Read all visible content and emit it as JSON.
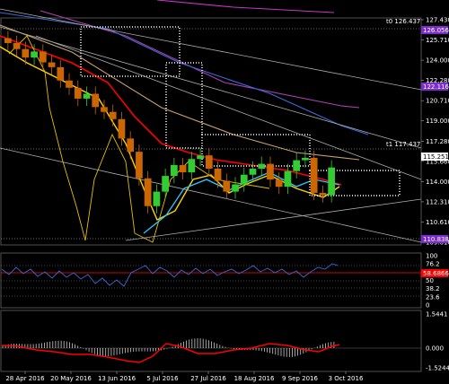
{
  "colors": {
    "background": "#000000",
    "bull_candle": "#33cc33",
    "bear_candle": "#cc6600",
    "ma_red": "#ff0000",
    "ma_yellow": "#ffd400",
    "ma_cyan": "#2ec8ff",
    "ma_blue": "#3b6bd9",
    "ma_purple": "#c04ac0",
    "ma_magenta": "#cc33cc",
    "ma_tan": "#d8b078",
    "cloud": "#ffffff",
    "tag_purple": "#7a2ccc",
    "tag_blue_grey": "#6c6c9a",
    "tag_current": "#ffffff",
    "rsi_line": "#3a6bd8",
    "macd_line": "#ff0000",
    "macd_hist": "#cccccc",
    "grid": "#444444",
    "trendline": "#bbbbbb"
  },
  "price_axis": {
    "labels": [
      "127.430",
      "125.710",
      "124.000",
      "122.280",
      "120.710",
      "119.000",
      "117.280",
      "115.660",
      "114.000",
      "112.310",
      "110.610",
      "109.010"
    ]
  },
  "price_tags": {
    "t0": "t0 126.437",
    "t1": "t1 117.437",
    "level_top": "126.056",
    "level_mid": "122.116",
    "current": "115.251",
    "level_low": "110.838"
  },
  "rsi_axis": {
    "labels": [
      "100",
      "76.2",
      "61.8",
      "50",
      "38.2",
      "23.6",
      "0"
    ],
    "current": "58.6866"
  },
  "macd_axis": {
    "labels": [
      "1.5441",
      "0.000",
      "-1.5244"
    ]
  },
  "time_axis": {
    "labels": [
      "28 Apr 2016",
      "20 May 2016",
      "13 Jun 2016",
      "5 Jul 2016",
      "27 Jul 2016",
      "18 Aug 2016",
      "9 Sep 2016",
      "3 Oct 2016"
    ]
  },
  "chart_data": {
    "type": "candlestick",
    "panes": [
      "price",
      "rsi",
      "macd"
    ],
    "ylim_price": [
      109.01,
      127.43
    ],
    "ylim_rsi": [
      0,
      100
    ],
    "ylim_macd": [
      -1.5244,
      1.5441
    ],
    "close_approx": [
      125.5,
      125.0,
      124.3,
      124.8,
      123.9,
      123.5,
      122.4,
      121.8,
      120.9,
      121.3,
      120.2,
      119.8,
      119.2,
      117.6,
      116.5,
      114.3,
      112.0,
      113.2,
      114.5,
      115.4,
      114.8,
      115.9,
      116.2,
      115.1,
      114.1,
      113.2,
      113.8,
      114.6,
      115.1,
      115.5,
      114.2,
      113.6,
      114.9,
      115.8,
      116.0,
      113.1,
      112.9,
      115.2
    ]
  }
}
